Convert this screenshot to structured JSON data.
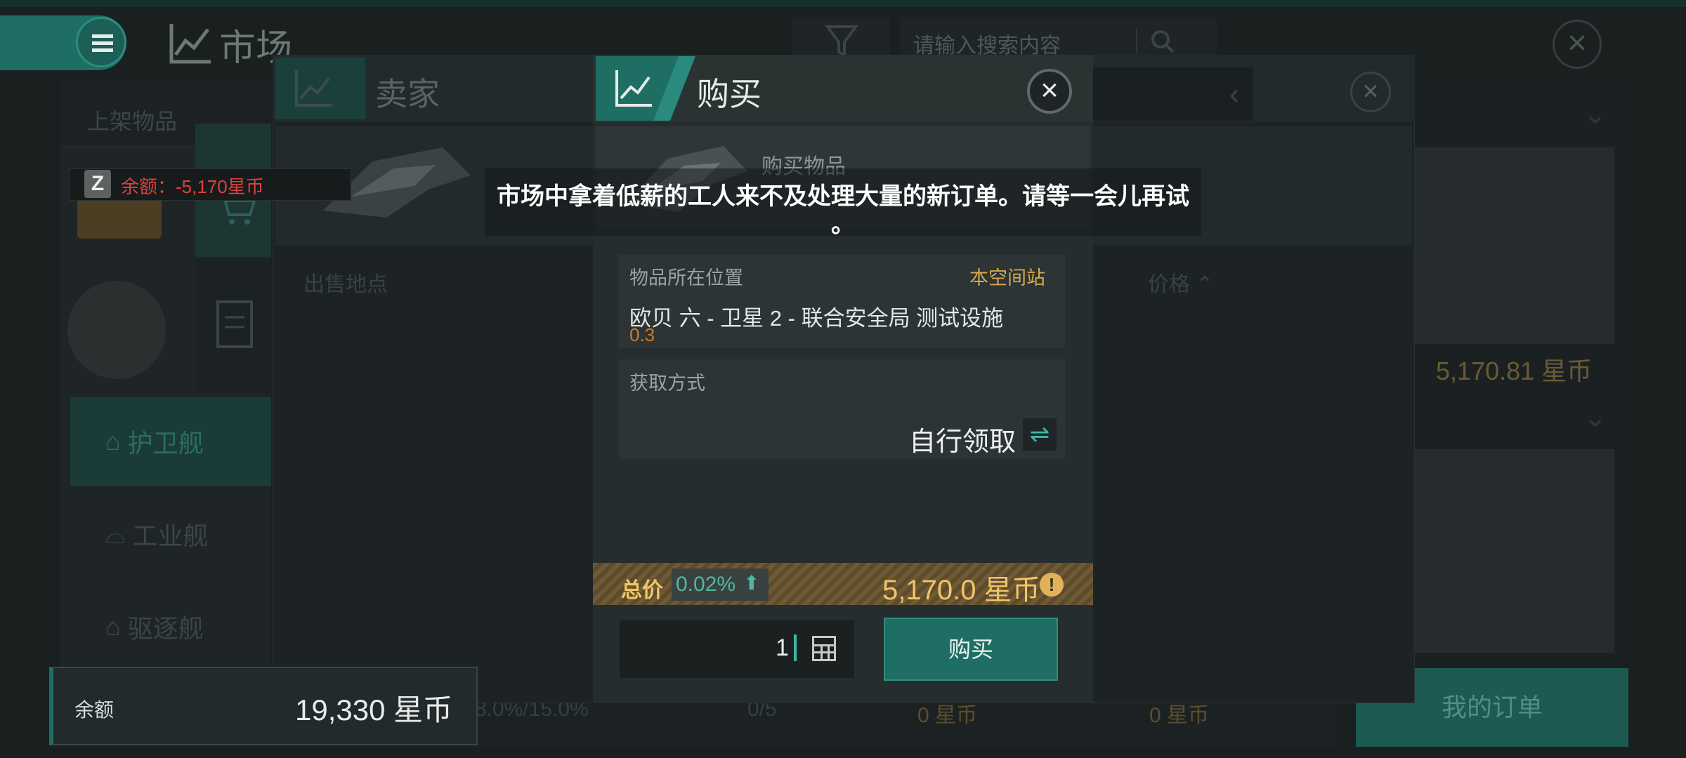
{
  "header": {
    "title": "市场",
    "search_placeholder": "请输入搜索内容"
  },
  "sidebar": {
    "listed_items_label": "上架物品",
    "categories": [
      {
        "label": "护卫舰",
        "selected": true
      },
      {
        "label": "工业舰",
        "selected": false
      },
      {
        "label": "驱逐舰",
        "selected": false
      }
    ]
  },
  "balance_warning": {
    "badge": "Z",
    "text": "余额：-5,170星币"
  },
  "seller_dialog": {
    "title": "卖家",
    "location_column": "出售地点",
    "price_column": "价格"
  },
  "buy_dialog": {
    "title": "购买",
    "item_label": "购买物品",
    "location_label": "物品所在位置",
    "location_link": "本空间站",
    "location_name": "欧贝 六 - 卫星 2 - 联合安全局 测试设施",
    "security_status": "0.3",
    "method_label": "获取方式",
    "method_value": "自行领取",
    "total_label": "总价",
    "percent": "0.02%",
    "total_value": "5,170.0 星币",
    "quantity": "1",
    "buy_button": "购买"
  },
  "toast": {
    "line1": "市场中拿着低薪的工人来不及处理大量的新订单。请等一会儿再试",
    "line2": "。"
  },
  "right_panel": {
    "price_1": "5,170.81 星币"
  },
  "bottom_bar": {
    "balance_label": "余额",
    "balance_value": "19,330 星币",
    "tax_rate": "8.0%/15.0%",
    "order_count": "0/5",
    "coins_1": "0 星币",
    "coins_2": "0 星币",
    "my_orders_button": "我的订单"
  },
  "colors": {
    "accent": "#1f6e64",
    "gold": "#f3c468",
    "warning": "#e0403a"
  }
}
